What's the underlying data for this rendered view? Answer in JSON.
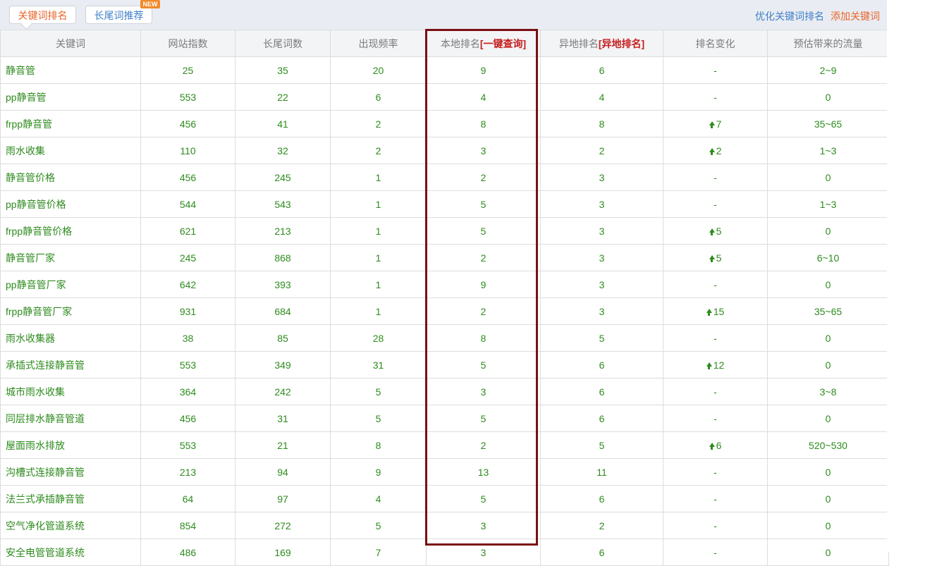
{
  "tabs": {
    "active_label": "关键词排名",
    "second_label": "长尾词推荐",
    "new_badge": "NEW"
  },
  "top_links": {
    "optimize": "优化关键词排名",
    "add": "添加关键词"
  },
  "table": {
    "headers": {
      "keyword": "关键词",
      "site_index": "网站指数",
      "longtail": "长尾词数",
      "frequency": "出现频率",
      "local_rank": "本地排名",
      "local_rank_link": "[一键查询]",
      "remote_rank": "异地排名",
      "remote_rank_link": "[异地排名]",
      "rank_change": "排名变化",
      "traffic": "预估带来的流量"
    },
    "rows": [
      {
        "keyword": "静音管",
        "site_index": "25",
        "longtail": "35",
        "frequency": "20",
        "local_rank": "9",
        "remote_rank": "6",
        "change": "-",
        "up": false,
        "traffic": "2~9"
      },
      {
        "keyword": "pp静音管",
        "site_index": "553",
        "longtail": "22",
        "frequency": "6",
        "local_rank": "4",
        "remote_rank": "4",
        "change": "-",
        "up": false,
        "traffic": "0"
      },
      {
        "keyword": "frpp静音管",
        "site_index": "456",
        "longtail": "41",
        "frequency": "2",
        "local_rank": "8",
        "remote_rank": "8",
        "change": "7",
        "up": true,
        "traffic": "35~65"
      },
      {
        "keyword": "雨水收集",
        "site_index": "110",
        "longtail": "32",
        "frequency": "2",
        "local_rank": "3",
        "remote_rank": "2",
        "change": "2",
        "up": true,
        "traffic": "1~3"
      },
      {
        "keyword": "静音管价格",
        "site_index": "456",
        "longtail": "245",
        "frequency": "1",
        "local_rank": "2",
        "remote_rank": "3",
        "change": "-",
        "up": false,
        "traffic": "0"
      },
      {
        "keyword": "pp静音管价格",
        "site_index": "544",
        "longtail": "543",
        "frequency": "1",
        "local_rank": "5",
        "remote_rank": "3",
        "change": "-",
        "up": false,
        "traffic": "1~3"
      },
      {
        "keyword": "frpp静音管价格",
        "site_index": "621",
        "longtail": "213",
        "frequency": "1",
        "local_rank": "5",
        "remote_rank": "3",
        "change": "5",
        "up": true,
        "traffic": "0"
      },
      {
        "keyword": "静音管厂家",
        "site_index": "245",
        "longtail": "868",
        "frequency": "1",
        "local_rank": "2",
        "remote_rank": "3",
        "change": "5",
        "up": true,
        "traffic": "6~10"
      },
      {
        "keyword": "pp静音管厂家",
        "site_index": "642",
        "longtail": "393",
        "frequency": "1",
        "local_rank": "9",
        "remote_rank": "3",
        "change": "-",
        "up": false,
        "traffic": "0"
      },
      {
        "keyword": "frpp静音管厂家",
        "site_index": "931",
        "longtail": "684",
        "frequency": "1",
        "local_rank": "2",
        "remote_rank": "3",
        "change": "15",
        "up": true,
        "traffic": "35~65"
      },
      {
        "keyword": "雨水收集器",
        "site_index": "38",
        "longtail": "85",
        "frequency": "28",
        "local_rank": "8",
        "remote_rank": "5",
        "change": "-",
        "up": false,
        "traffic": "0"
      },
      {
        "keyword": "承插式连接静音管",
        "site_index": "553",
        "longtail": "349",
        "frequency": "31",
        "local_rank": "5",
        "remote_rank": "6",
        "change": "12",
        "up": true,
        "traffic": "0"
      },
      {
        "keyword": "城市雨水收集",
        "site_index": "364",
        "longtail": "242",
        "frequency": "5",
        "local_rank": "3",
        "remote_rank": "6",
        "change": "-",
        "up": false,
        "traffic": "3~8"
      },
      {
        "keyword": "同层排水静音管道",
        "site_index": "456",
        "longtail": "31",
        "frequency": "5",
        "local_rank": "5",
        "remote_rank": "6",
        "change": "-",
        "up": false,
        "traffic": "0"
      },
      {
        "keyword": "屋面雨水排放",
        "site_index": "553",
        "longtail": "21",
        "frequency": "8",
        "local_rank": "2",
        "remote_rank": "5",
        "change": "6",
        "up": true,
        "traffic": "520~530"
      },
      {
        "keyword": "沟槽式连接静音管",
        "site_index": "213",
        "longtail": "94",
        "frequency": "9",
        "local_rank": "13",
        "remote_rank": "11",
        "change": "-",
        "up": false,
        "traffic": "0"
      },
      {
        "keyword": "法兰式承插静音管",
        "site_index": "64",
        "longtail": "97",
        "frequency": "4",
        "local_rank": "5",
        "remote_rank": "6",
        "change": "-",
        "up": false,
        "traffic": "0"
      },
      {
        "keyword": "空气净化管道系统",
        "site_index": "854",
        "longtail": "272",
        "frequency": "5",
        "local_rank": "3",
        "remote_rank": "2",
        "change": "-",
        "up": false,
        "traffic": "0"
      },
      {
        "keyword": "安全电管管道系统",
        "site_index": "486",
        "longtail": "169",
        "frequency": "7",
        "local_rank": "3",
        "remote_rank": "6",
        "change": "-",
        "up": false,
        "traffic": "0"
      }
    ]
  },
  "colors": {
    "value_green": "#2e8b1e",
    "highlight_border": "#7b0f12",
    "accent_orange": "#e8642a",
    "link_blue": "#3d7fc7"
  }
}
